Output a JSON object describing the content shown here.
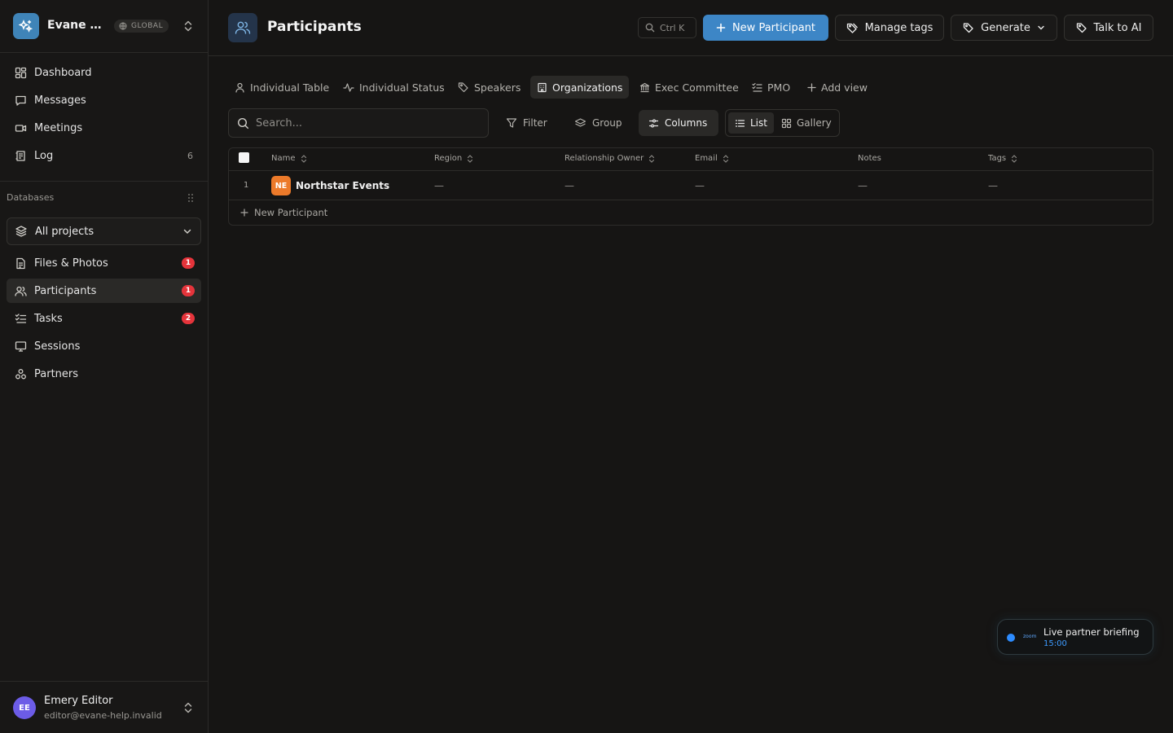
{
  "workspace": {
    "name": "Evane He...",
    "badge": "GLOBAL"
  },
  "nav": [
    {
      "label": "Dashboard",
      "icon": "dashboard-icon"
    },
    {
      "label": "Messages",
      "icon": "message-icon"
    },
    {
      "label": "Meetings",
      "icon": "video-icon"
    },
    {
      "label": "Log",
      "icon": "log-icon",
      "count": "6"
    }
  ],
  "databases": {
    "label": "Databases",
    "project_select": "All projects",
    "items": [
      {
        "label": "Files & Photos",
        "icon": "file-icon",
        "badge": "1"
      },
      {
        "label": "Participants",
        "icon": "users-icon",
        "badge": "1",
        "active": true
      },
      {
        "label": "Tasks",
        "icon": "tasks-icon",
        "badge": "2"
      },
      {
        "label": "Sessions",
        "icon": "presentation-icon"
      },
      {
        "label": "Partners",
        "icon": "partners-icon"
      }
    ]
  },
  "user": {
    "name": "Emery Editor",
    "email": "editor@evane-help.invalid",
    "initials": "EE"
  },
  "header": {
    "title": "Participants",
    "kbd": "Ctrl K",
    "new_button": "New Participant",
    "manage_tags": "Manage tags",
    "generate": "Generate",
    "talk_ai": "Talk to AI"
  },
  "tabs": [
    {
      "label": "Individual Table",
      "icon": "person-icon"
    },
    {
      "label": "Individual Status",
      "icon": "activity-icon"
    },
    {
      "label": "Speakers",
      "icon": "tag-icon"
    },
    {
      "label": "Organizations",
      "icon": "building-icon",
      "active": true
    },
    {
      "label": "Exec Committee",
      "icon": "bank-icon"
    },
    {
      "label": "PMO",
      "icon": "list-check-icon"
    },
    {
      "label": "Add view",
      "icon": "plus-icon"
    }
  ],
  "toolbar": {
    "search_placeholder": "Search...",
    "filter": "Filter",
    "group": "Group",
    "columns": "Columns",
    "list": "List",
    "gallery": "Gallery"
  },
  "table": {
    "columns": [
      "Name",
      "Region",
      "Relationship Owner",
      "Email",
      "Notes",
      "Tags"
    ],
    "rows": [
      {
        "num": "1",
        "initials": "NE",
        "name": "Northstar Events",
        "region": "—",
        "owner": "—",
        "email": "—",
        "notes": "—",
        "tags": "—"
      }
    ],
    "new_row": "New Participant"
  },
  "event": {
    "source": "zoom",
    "title": "Live partner briefing",
    "time": "15:00"
  },
  "colors": {
    "accent": "#3d86c6",
    "badge": "#e5343b",
    "org_chip": "#ec7a2a",
    "avatar": "#6c5ce7"
  }
}
